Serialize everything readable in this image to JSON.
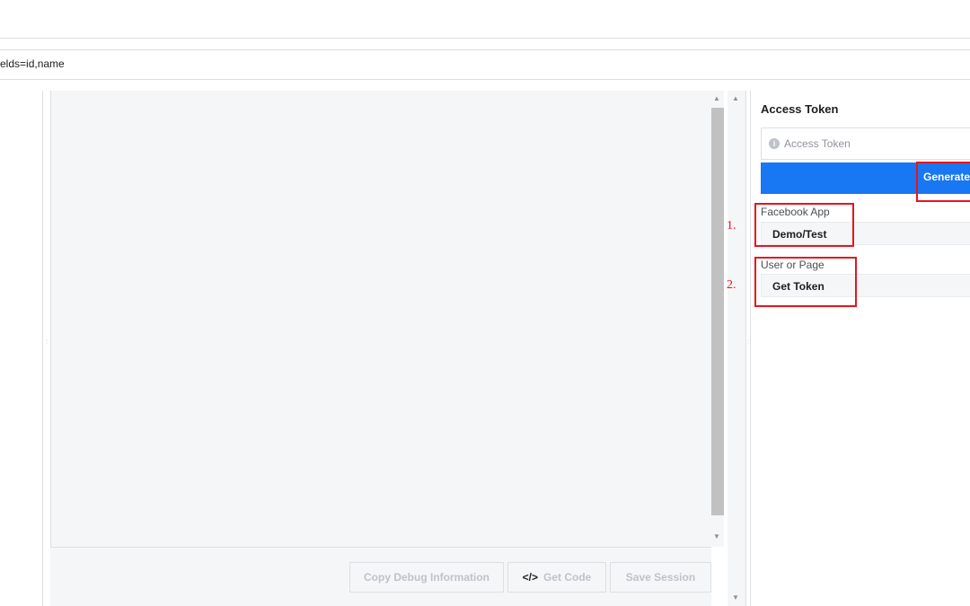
{
  "query": {
    "text": "elds=id,name"
  },
  "toolbar": {
    "copy_debug_label": "Copy Debug Information",
    "get_code_icon": "</>",
    "get_code_label": "Get Code",
    "save_session_label": "Save Session"
  },
  "panel": {
    "title": "Access Token",
    "token_placeholder": "Access Token",
    "info_icon": "i",
    "generate_label": "Generate",
    "facebook_app_label": "Facebook App",
    "facebook_app_value": "Demo/Test",
    "user_or_page_label": "User or Page",
    "user_or_page_value": "Get Token"
  },
  "annotations": {
    "step1": "1.",
    "step2": "2."
  },
  "colors": {
    "primary": "#1877f2",
    "highlight": "#e8141c",
    "pane": "#f5f6f7"
  }
}
